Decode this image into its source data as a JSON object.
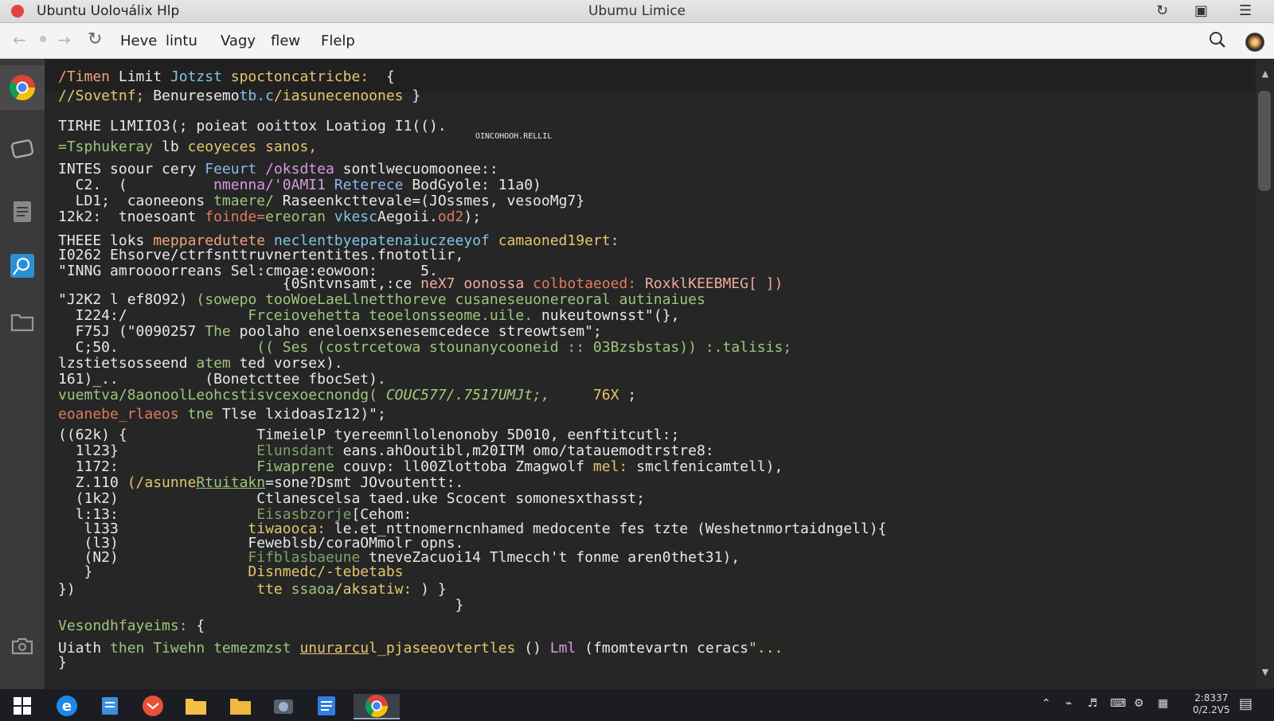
{
  "titlebar": {
    "app_title": "Ubuntu Uoloчálix  Hlp",
    "window_title": "Ubumu Limice"
  },
  "toolbar": {
    "menu": [
      "Heve",
      "lintu",
      "Vagy",
      "flew",
      "Flelp"
    ]
  },
  "terminal": {
    "lines": [
      [
        [
          "/Timen ",
          "o"
        ],
        [
          "Limit ",
          "w"
        ],
        [
          "Jotzst ",
          "c"
        ],
        [
          "spoctoncatricbe:  ",
          "y"
        ],
        [
          "{",
          "w"
        ]
      ],
      [
        [
          "//Sovetnf; ",
          "y"
        ],
        [
          "Benuresemo",
          "w"
        ],
        [
          "tb.c",
          "c"
        ],
        [
          "/iasunecenoones ",
          "y"
        ],
        [
          "}",
          "w"
        ]
      ],
      [
        [
          "TIRHE L1MIIO3(; poieat ooittox Loatiog I1(().",
          "w"
        ]
      ],
      [
        [
          "OINCOHOOH.RELLIL",
          "w"
        ]
      ],
      [
        [
          "=Tsphukeray ",
          "g"
        ],
        [
          "lb ",
          "w"
        ],
        [
          "ceoyeces sanos,",
          "y"
        ]
      ],
      [
        [
          "INTES ",
          "w"
        ],
        [
          "soour cery ",
          "w"
        ],
        [
          "Feeurt ",
          "b"
        ],
        [
          "/oksdtea ",
          "p"
        ],
        [
          "sontlwecuomoonee::",
          "w"
        ]
      ],
      [
        [
          "  C2.  (          ",
          "w"
        ],
        [
          "nmenna/'0AMI1 ",
          "p"
        ],
        [
          "Reterece ",
          "b"
        ],
        [
          "BodGyole: 11a0)",
          "w"
        ]
      ],
      [
        [
          "  LD1;  ",
          "w"
        ],
        [
          "caoneeons ",
          "w"
        ],
        [
          "tmaere/ ",
          "g"
        ],
        [
          "Raseenkcttevale=(JOssmes, ",
          "w"
        ],
        [
          "vesooMg7}",
          "w"
        ]
      ],
      [
        [
          "12k2:  ",
          "w"
        ],
        [
          "tnoesoant ",
          "w"
        ],
        [
          "foinde=",
          "r"
        ],
        [
          "ereoran ",
          "g"
        ],
        [
          "vkesc",
          "c"
        ],
        [
          "Aegoii.",
          "w"
        ],
        [
          "od2",
          "r"
        ],
        [
          ");",
          "w"
        ]
      ],
      [
        [
          "THEEE ",
          "w"
        ],
        [
          "loks ",
          "w"
        ],
        [
          "mepparedutete ",
          "o"
        ],
        [
          "neclentbyepatenaiuczeeyof ",
          "c"
        ],
        [
          "camaoned19ert:",
          "y"
        ]
      ],
      [
        [
          "I0262 ",
          "w"
        ],
        [
          "Ehsorve/ctrfsnttruvnertentites.fnototlir,",
          "w"
        ]
      ],
      [
        [
          "\"INNG ",
          "w"
        ],
        [
          "amroooorreans ",
          "w"
        ],
        [
          "Sel:cmoae:eowoon:     5.",
          "w"
        ]
      ],
      [
        [
          "                          {0Sntvnsamt,:ce ",
          "w"
        ],
        [
          "neX7 ",
          "cr"
        ],
        [
          "oonossa ",
          "cr"
        ],
        [
          "colbotaeoed: ",
          "r"
        ],
        [
          "RoxklKEEBMEG[ ])",
          "cr"
        ]
      ],
      [
        [
          "\"J2K2 ",
          "w"
        ],
        [
          "l ",
          "w"
        ],
        [
          "ef8O92) ",
          "w"
        ],
        [
          "(sowepo tooWoeLaeLlnetthoreve ",
          "g"
        ],
        [
          "cusaneseuonereoral ",
          "g"
        ],
        [
          "autinaiues",
          "g"
        ]
      ],
      [
        [
          "  I224:/              ",
          "w"
        ],
        [
          "Frceiovehetta teoelonsseome.uile. ",
          "g"
        ],
        [
          "nukeutownsst\"(}, ",
          "w"
        ]
      ],
      [
        [
          "  F75J (\"0090257 ",
          "w"
        ],
        [
          "The ",
          "g"
        ],
        [
          "poolaho ",
          "w"
        ],
        [
          "eneloenxsenesemcedece ",
          "w"
        ],
        [
          "streowtsem\";",
          "w"
        ]
      ],
      [
        [
          "  C;50.                ",
          "w"
        ],
        [
          "(( Ses (costrcetowa stounanycooneid :: 03Bz",
          "g"
        ],
        [
          "sbstas)) :.talisis;",
          "g"
        ]
      ],
      [
        [
          "lzstietsosseend ",
          "w"
        ],
        [
          "atem ",
          "g"
        ],
        [
          "ted vorsex).",
          "w"
        ]
      ],
      [
        [
          "161)_..          ",
          "w"
        ],
        [
          "(Bonetcttee fbocSet).",
          "w"
        ]
      ],
      [
        [
          "vuemtva/8aonoolLeohcstisvcexoecnondg( ",
          "g"
        ],
        [
          "COUC577/.7517UMJt;,     ",
          "gi"
        ],
        [
          "76X ",
          "y"
        ],
        [
          ";",
          "w"
        ]
      ],
      [
        [
          "eoanebe_rlaeos ",
          "r"
        ],
        [
          "tne ",
          "g"
        ],
        [
          "Tlse ",
          "w"
        ],
        [
          "lxidoasIz12)\";",
          "w"
        ]
      ],
      [
        [
          "((62k) {               ",
          "w"
        ],
        [
          "TimeielP ",
          "w"
        ],
        [
          "tyereemnllolenonoby ",
          "w"
        ],
        [
          "5D010, eenftitcutl:;",
          "w"
        ]
      ],
      [
        [
          "  1l23}                ",
          "w"
        ],
        [
          "Elunsdant ",
          "gr"
        ],
        [
          "eans.ahOoutibl,m20ITM ",
          "w"
        ],
        [
          "omo/tatauemodtrstre8:",
          "w"
        ]
      ],
      [
        [
          "  1172:                ",
          "w"
        ],
        [
          "Fiwaprene ",
          "g"
        ],
        [
          "couvp: ",
          "w"
        ],
        [
          "ll00Zlottoba ",
          "w"
        ],
        [
          "Zmagwolf ",
          "w"
        ],
        [
          "mel: ",
          "y"
        ],
        [
          "smclfenicamtell),",
          "w"
        ]
      ],
      [
        [
          "  Z.110 ",
          "w"
        ],
        [
          "(/asunne",
          "y"
        ],
        [
          "Rtuitakn",
          "u g"
        ],
        [
          "=sone?Dsmt ",
          "w"
        ],
        [
          "JOvoutentt:.",
          "w"
        ]
      ],
      [
        [
          "  (1k2)                ",
          "w"
        ],
        [
          "Ctlanescelsa ",
          "w"
        ],
        [
          "taed.uke ",
          "w"
        ],
        [
          "Scocent ",
          "w"
        ],
        [
          "somonesxthasst;",
          "w"
        ]
      ],
      [
        [
          "  l:13:                ",
          "w"
        ],
        [
          "Eisasbzorje",
          "gr"
        ],
        [
          "[Cehom:",
          "w"
        ]
      ],
      [
        [
          "   l133               ",
          "w"
        ],
        [
          "tiwaooca: ",
          "y"
        ],
        [
          "le.et_nttnomerncnhamed ",
          "w"
        ],
        [
          "medocente ",
          "w"
        ],
        [
          "fes ",
          "w"
        ],
        [
          "tzte ",
          "w"
        ],
        [
          "(Weshetnmortaidngell){",
          "w"
        ]
      ],
      [
        [
          "   (l3)               ",
          "w"
        ],
        [
          "Feweblsb/coraOMmolr ",
          "w"
        ],
        [
          "opns.",
          "w"
        ]
      ],
      [
        [
          "   (N2)               ",
          "w"
        ],
        [
          "Fifblasbaeune ",
          "gr"
        ],
        [
          "tneveZacuoi14 ",
          "w"
        ],
        [
          "Tlmecch't ",
          "w"
        ],
        [
          "fonme ",
          "w"
        ],
        [
          "aren0thet31),",
          "w"
        ]
      ],
      [
        [
          "   }                  ",
          "w"
        ],
        [
          "Disnmedc/-tebetabs",
          "y"
        ]
      ],
      [
        [
          "})                     ",
          "w"
        ],
        [
          "tte ",
          "y"
        ],
        [
          "ssaoa",
          "g"
        ],
        [
          "/aksatiw: ",
          "y"
        ],
        [
          ") }",
          "w"
        ]
      ],
      [
        [
          "                                              }",
          "w"
        ]
      ],
      [
        [
          "Vesondhfayeims: ",
          "g"
        ],
        [
          "{",
          "w"
        ]
      ],
      [
        [
          "Uiath ",
          "w"
        ],
        [
          "then ",
          "g"
        ],
        [
          "Tiwehn ",
          "g"
        ],
        [
          "temezmzst ",
          "g"
        ],
        [
          "unurarcu",
          "u y"
        ],
        [
          "l_pjasee",
          "y"
        ],
        [
          "ovtertles ",
          "y"
        ],
        [
          "() ",
          "w"
        ],
        [
          "Lml ",
          "p"
        ],
        [
          "(fmomtevartn ",
          "w"
        ],
        [
          "ceracs",
          "w"
        ],
        [
          "\"...",
          "y"
        ]
      ],
      [
        [
          "}",
          "w"
        ]
      ]
    ]
  },
  "tray": {
    "clock_time": "2:8337",
    "clock_date": "0/2.2V5"
  }
}
